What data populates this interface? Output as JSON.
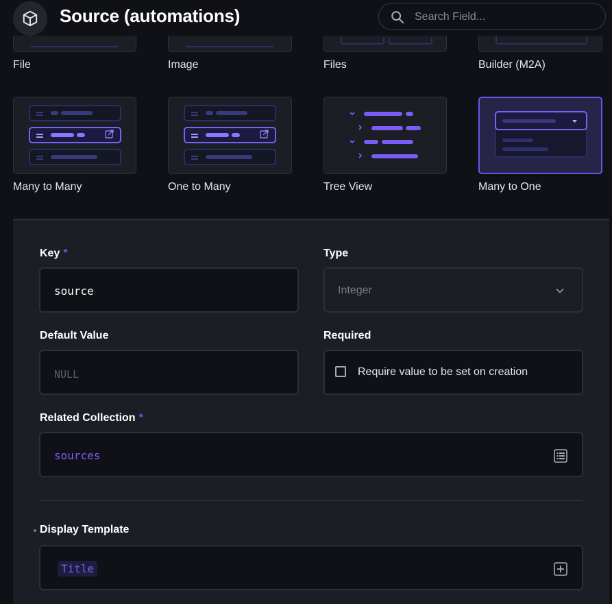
{
  "header": {
    "title": "Source (automations)",
    "icon": "cube-icon",
    "search_placeholder": "Search Field..."
  },
  "interfaces_top": [
    {
      "label": "File"
    },
    {
      "label": "Image"
    },
    {
      "label": "Files"
    },
    {
      "label": "Builder (M2A)"
    }
  ],
  "interfaces": [
    {
      "label": "Many to Many",
      "selected": false
    },
    {
      "label": "One to Many",
      "selected": false
    },
    {
      "label": "Tree View",
      "selected": false
    },
    {
      "label": "Many to One",
      "selected": true
    }
  ],
  "form": {
    "key": {
      "label": "Key",
      "required_mark": "*",
      "value": "source"
    },
    "type": {
      "label": "Type",
      "value": "Integer"
    },
    "default_value": {
      "label": "Default Value",
      "placeholder": "NULL"
    },
    "required": {
      "label": "Required",
      "checkbox_label": "Require value to be set on creation",
      "checked": false
    },
    "related_collection": {
      "label": "Related Collection",
      "required_mark": "*",
      "value": "sources"
    },
    "display_template": {
      "label": "Display Template",
      "chip": "Title"
    }
  },
  "colors": {
    "accent": "#6b55e8",
    "background": "#0f1117",
    "panel": "#1b1e25",
    "border": "#2b2f38"
  }
}
